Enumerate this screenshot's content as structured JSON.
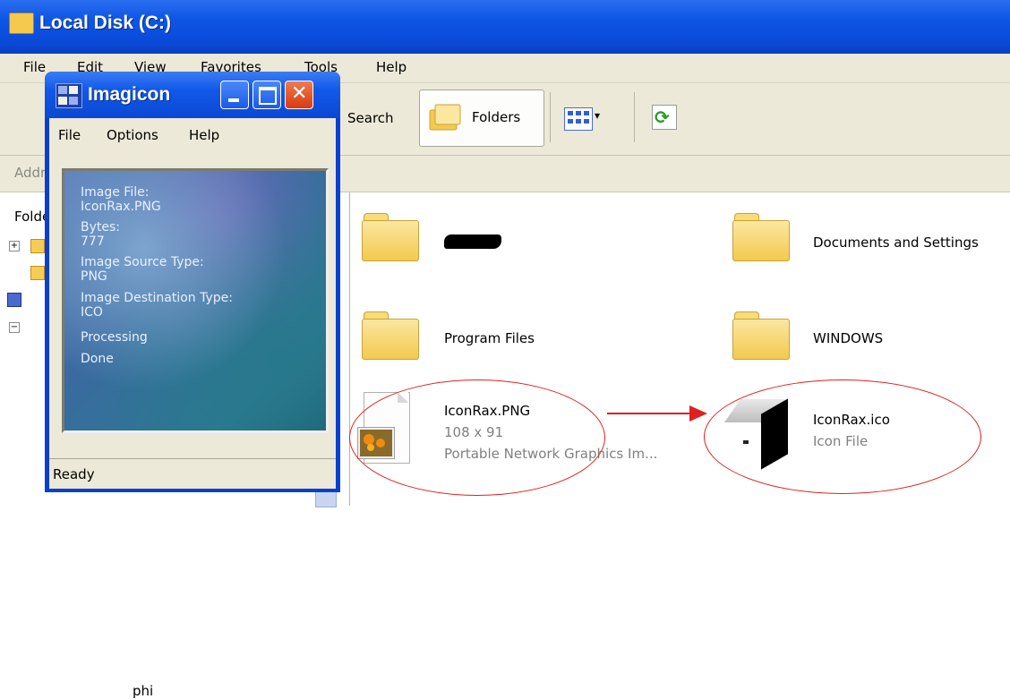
{
  "explorer": {
    "title": "Local Disk (C:)",
    "menu": [
      "File",
      "Edit",
      "View",
      "Favorites",
      "Tools",
      "Help"
    ],
    "toolbar": {
      "search_label": "Search",
      "folders_label": "Folders"
    },
    "address_label": "Address",
    "left_pane": {
      "header": "Folders",
      "partial_item": "phi"
    },
    "items": [
      {
        "name": "",
        "type": "folder"
      },
      {
        "name": "Documents and Settings",
        "type": "folder"
      },
      {
        "name": "Program Files",
        "type": "folder"
      },
      {
        "name": "WINDOWS",
        "type": "folder"
      },
      {
        "name": "IconRax.PNG",
        "line2": "108 x 91",
        "line3": "Portable Network Graphics Im...",
        "type": "png"
      },
      {
        "name": "IconRax.ico",
        "line2": "Icon File",
        "type": "ico"
      }
    ]
  },
  "imagicon": {
    "title": "Imagicon",
    "menu": [
      "File",
      "Options",
      "Help"
    ],
    "panel_lines": [
      "Image File:",
      "IconRax.PNG",
      "Bytes:",
      "777",
      "Image Source Type:",
      "PNG",
      "Image Destination Type:",
      "ICO",
      "Processing",
      "Done"
    ],
    "status": "Ready"
  },
  "colors": {
    "title_blue": "#0a49d8",
    "annotation_red": "#e02020",
    "chrome": "#ece9d8"
  }
}
